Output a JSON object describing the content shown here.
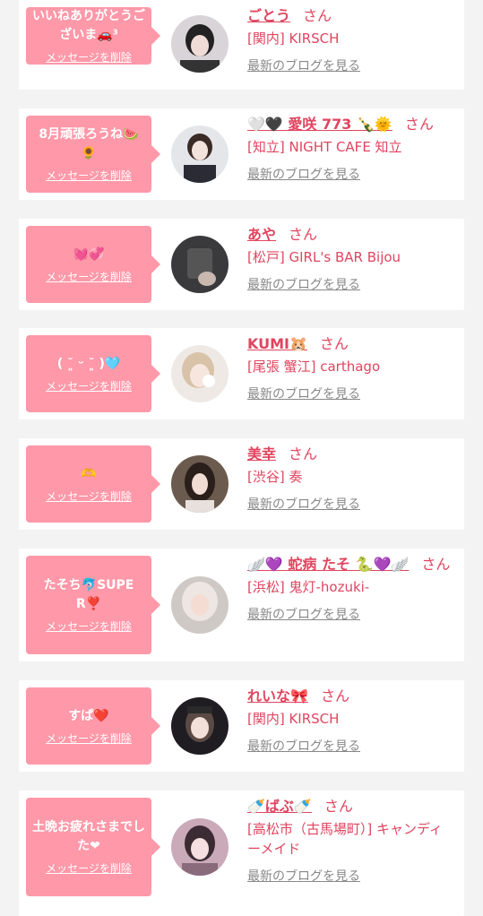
{
  "delete_label": "メッセージを削除",
  "blog_label": "最新のブログを見る",
  "san_label": "さん",
  "colors": {
    "accent": "#e0455f",
    "bubble": "#ff98a8",
    "background": "#f3f3f3"
  },
  "cards": [
    {
      "message": "いいねありがとうございま🚗³",
      "name": "ごとう",
      "shop": "[関内] KIRSCH",
      "avatar": "avatar-photo"
    },
    {
      "message": "8月頑張ろうね🍉🌻",
      "name": "🤍🖤 愛咲 773 🍾🌞",
      "shop": "[知立] NIGHT CAFE 知立",
      "avatar": "avatar-photo"
    },
    {
      "message": "💓💞",
      "name": "あや",
      "shop": "[松戸] GIRL's BAR Bijou",
      "avatar": "avatar-photo"
    },
    {
      "message": "( ˘͈ ᵕ ˘͈ )🩵",
      "name": "KUMI🐹",
      "shop": "[尾張 蟹江] carthago",
      "avatar": "avatar-photo"
    },
    {
      "message": "🫶",
      "name": "美幸",
      "shop": "[渋谷] 奏",
      "avatar": "avatar-photo"
    },
    {
      "message": "たそち🐬SUPER❣️",
      "name": "🪽💜 蛇病 たそ 🐍💜🪽",
      "shop": "[浜松] 鬼灯-hozuki-",
      "avatar": "avatar-photo"
    },
    {
      "message": "すぱ❤️",
      "name": "れいな🎀",
      "shop": "[関内] KIRSCH",
      "avatar": "avatar-photo"
    },
    {
      "message": "土晩お疲れさまでした❤",
      "name": "🍼ばぶ🍼",
      "shop": "[高松市（古馬場町）] キャンディーメイド",
      "avatar": "avatar-photo"
    }
  ]
}
